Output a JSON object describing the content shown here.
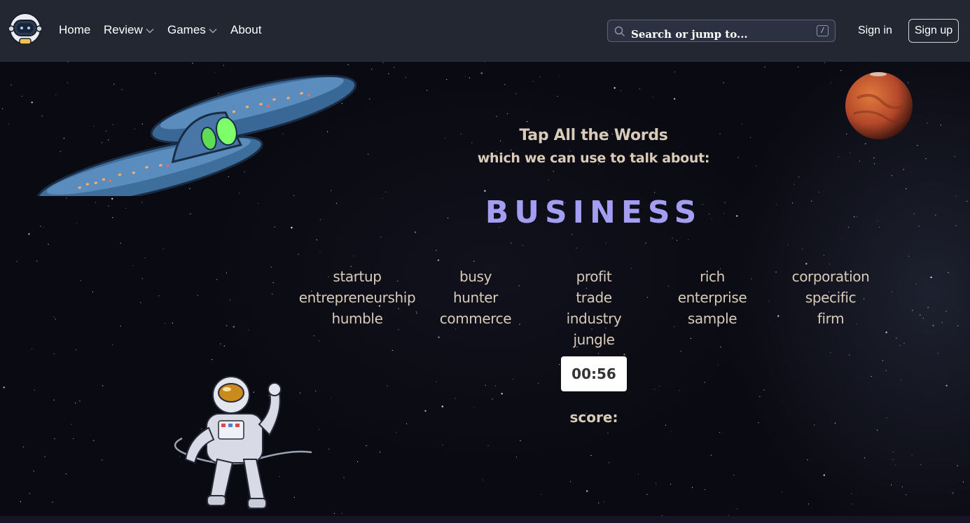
{
  "nav": {
    "links": [
      {
        "label": "Home",
        "dropdown": false
      },
      {
        "label": "Review",
        "dropdown": true
      },
      {
        "label": "Games",
        "dropdown": true
      },
      {
        "label": "About",
        "dropdown": false
      }
    ],
    "search_placeholder": "Search or jump to...",
    "search_shortcut": "/",
    "signin_label": "Sign in",
    "signup_label": "Sign up"
  },
  "game": {
    "instruction_line1": "Tap All the Words",
    "instruction_line2": "which we can use to talk about:",
    "topic": "BUSINESS",
    "word_columns": [
      [
        "startup",
        "entrepreneurship",
        "humble"
      ],
      [
        "busy",
        "hunter",
        "commerce"
      ],
      [
        "profit",
        "trade",
        "industry",
        "jungle"
      ],
      [
        "rich",
        "enterprise",
        "sample"
      ],
      [
        "corporation",
        "specific",
        "firm"
      ]
    ],
    "timer": "00:56",
    "score_label": "score:"
  },
  "colors": {
    "header_bg": "#222731",
    "text": "#d9cbb8",
    "topic": "#a49ef3",
    "timer_bg": "#ffffff"
  },
  "icons": [
    "robot-logo-icon",
    "chevron-down-icon",
    "search-icon",
    "spaceship-illustration",
    "mars-planet-illustration",
    "astronaut-illustration"
  ]
}
